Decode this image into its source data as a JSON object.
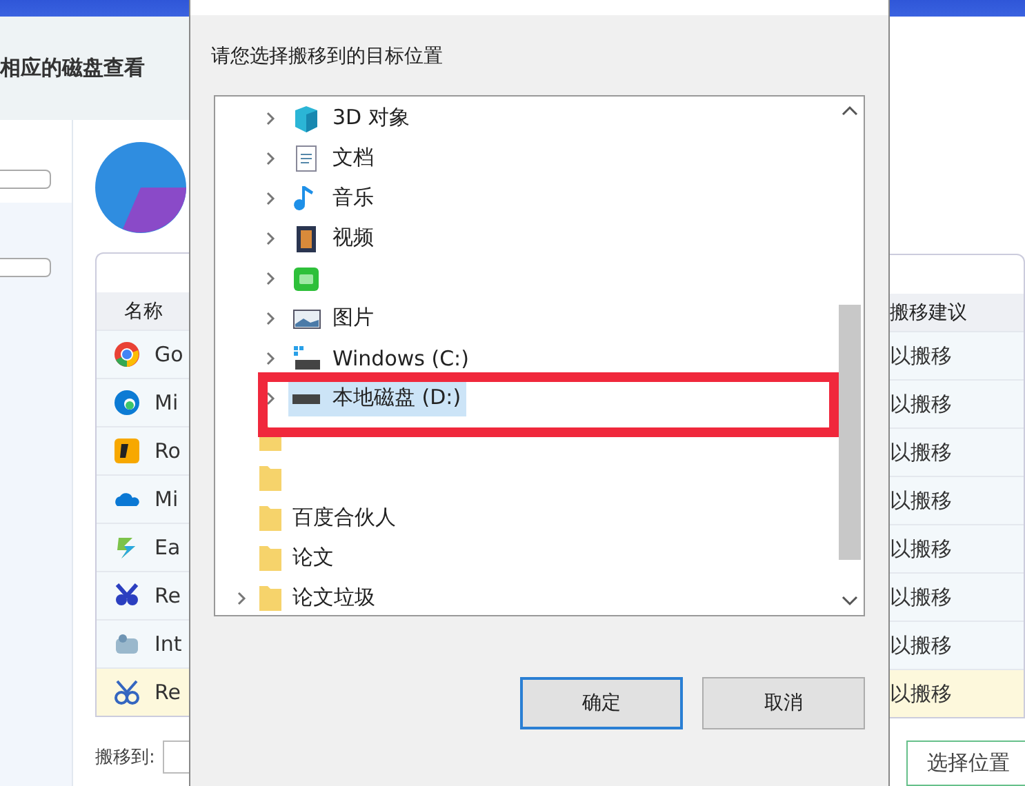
{
  "app": {
    "heading": "相应的磁盘查看",
    "table": {
      "columns": [
        "名称",
        "搬移建议"
      ],
      "rows": [
        {
          "kind": "chrome",
          "name": "Go",
          "advice": "以搬移",
          "selected": false
        },
        {
          "kind": "edge",
          "name": "Mi",
          "advice": "以搬移",
          "selected": false
        },
        {
          "kind": "rockstar",
          "name": "Ro",
          "advice": "以搬移",
          "selected": false
        },
        {
          "kind": "cloud",
          "name": "Mi",
          "advice": "以搬移",
          "selected": false
        },
        {
          "kind": "easy",
          "name": "Ea",
          "advice": "以搬移",
          "selected": false
        },
        {
          "kind": "bug",
          "name": "Re",
          "advice": "以搬移",
          "selected": false
        },
        {
          "kind": "intel",
          "name": "Int",
          "advice": "以搬移",
          "selected": false
        },
        {
          "kind": "bug2",
          "name": "Re",
          "advice": "以搬移",
          "selected": true
        }
      ]
    },
    "move_to_label": "搬移到:",
    "choose_button": "选择位置"
  },
  "dialog": {
    "prompt": "请您选择搬移到的目标位置",
    "pc_items": [
      {
        "kind": "cube",
        "label": "3D 对象",
        "expandable": true,
        "selected": false
      },
      {
        "kind": "doc",
        "label": "文档",
        "expandable": true,
        "selected": false
      },
      {
        "kind": "music",
        "label": "音乐",
        "expandable": true,
        "selected": false
      },
      {
        "kind": "film",
        "label": "视频",
        "expandable": true,
        "selected": false
      },
      {
        "kind": "greenapp",
        "expandable": true,
        "selected": false
      },
      {
        "kind": "image",
        "label": "图片",
        "expandable": true,
        "selected": false
      },
      {
        "kind": "sysdrive",
        "label": "Windows (C:)",
        "expandable": true,
        "selected": false
      },
      {
        "kind": "drive",
        "label": "本地磁盘 (D:)",
        "expandable": true,
        "selected": true
      }
    ],
    "folders": [
      {
        "expandable": false
      },
      {
        "expandable": false
      },
      {
        "label": "百度合伙人",
        "expandable": false
      },
      {
        "label": "论文",
        "expandable": false
      },
      {
        "label": "论文垃圾",
        "expandable": true
      }
    ],
    "buttons": [
      {
        "label": "确定",
        "default": true
      },
      {
        "label": "取消",
        "default": false
      }
    ]
  }
}
